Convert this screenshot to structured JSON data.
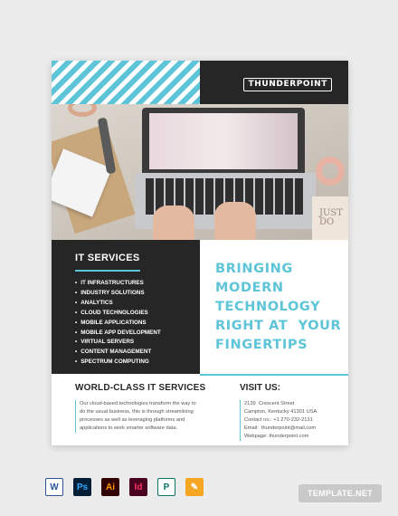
{
  "brand": {
    "logo_text": "THUNDERPOINT"
  },
  "photo": {
    "card_text": "JUST\nDO"
  },
  "services": {
    "title": "IT SERVICES",
    "items": [
      "IT INFRASTRUCTURES",
      "INDUSTRY SOLUTIONS",
      "ANALYTICS",
      "CLOUD TECHNOLOGIES",
      "MOBILE APPLICATIONS",
      "MOBILE APP DEVELOPMENT",
      "VIRTUAL SERVERS",
      "CONTENT MANAGEMENT",
      "SPECTRUM COMPUTING"
    ]
  },
  "headline": {
    "lines": [
      "BRINGING",
      "MODERN",
      "TECHNOLOGY",
      "RIGHT AT  YOUR",
      "FINGERTIPS"
    ]
  },
  "world": {
    "title": "WORLD-CLASS IT SERVICES",
    "body": "Our cloud-based technologies transform the way to do the usual business, this is through streamlining processes as well as leveraging platforms and applications to work smarter software data."
  },
  "visit": {
    "title": "VISIT US:",
    "lines": [
      "2139  Crescent Street",
      "Campton, Kentucky 41301 USA",
      "Contact no.: +1 270-232-2131",
      "Email:  thunderpoint@mail.com",
      "Webpage: thunderpoint.com"
    ]
  },
  "app_icons": [
    {
      "name": "word-icon",
      "label": "W",
      "bg": "#ffffff",
      "fg": "#2b5797"
    },
    {
      "name": "photoshop-icon",
      "label": "Ps",
      "bg": "#001e36",
      "fg": "#31a8ff"
    },
    {
      "name": "illustrator-icon",
      "label": "Ai",
      "bg": "#330000",
      "fg": "#ff9a00"
    },
    {
      "name": "indesign-icon",
      "label": "Id",
      "bg": "#49021f",
      "fg": "#ff3366"
    },
    {
      "name": "publisher-icon",
      "label": "P",
      "bg": "#ffffff",
      "fg": "#077568"
    },
    {
      "name": "pages-icon",
      "label": "✎",
      "bg": "#f5a623",
      "fg": "#ffffff"
    }
  ],
  "watermark": "TEMPLATE.NET",
  "colors": {
    "accent": "#5ec4d8",
    "dark": "#262626"
  }
}
